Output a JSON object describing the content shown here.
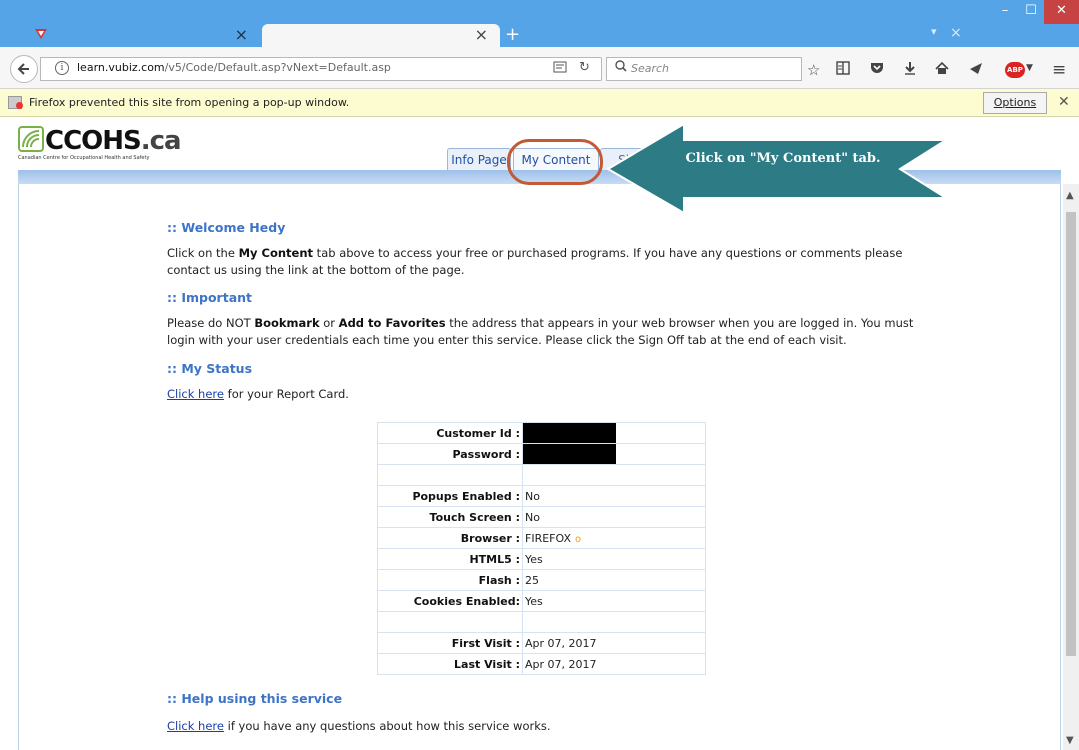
{
  "browser": {
    "tab1_title": "",
    "tab2_title": "",
    "tab_close": "×",
    "new_tab": "+",
    "list_all_tabs": "▾",
    "url_domain": "learn.vubiz.com",
    "url_path": "/v5/Code/Default.asp?vNext=Default.asp",
    "search_placeholder": "Search",
    "popup_message": "Firefox prevented this site from opening a pop-up window.",
    "options_label": "Options",
    "abp_label": "ABP",
    "window_min": "–",
    "window_max": "☐",
    "window_close": "✕"
  },
  "site": {
    "logo": "CCOHS",
    "logo_suffix": ".ca",
    "logo_sub": "Canadian Centre for Occupational Health and Safety",
    "tabs": [
      {
        "label": "Info Page"
      },
      {
        "label": "My Content"
      },
      {
        "label": "Sign Off"
      }
    ]
  },
  "annotation": {
    "callout": "Click on \"My Content\" tab."
  },
  "welcome": {
    "heading": ":: Welcome Hedy",
    "p_1": "Click on the ",
    "p_bold": "My Content",
    "p_2": " tab above to access your free or purchased programs.  If you have any questions or comments please contact us using the link at the bottom of the page."
  },
  "important": {
    "heading": ":: Important",
    "p_1": "Please do NOT ",
    "b_1": "Bookmark",
    "p_2": " or ",
    "b_2": "Add to Favorites",
    "p_3": " the address that appears in your web browser when you are logged in. You must login with your user credentials each time you enter this service. Please click the Sign Off tab at the end of each visit."
  },
  "status": {
    "heading": ":: My Status",
    "link": "Click here",
    "link_suffix": " for your Report Card.",
    "rows": [
      {
        "key": "Customer Id :",
        "value": ""
      },
      {
        "key": "Password :",
        "value": ""
      },
      {
        "key": "",
        "value": ""
      },
      {
        "key": "Popups Enabled :",
        "value": "No"
      },
      {
        "key": "Touch Screen :",
        "value": "No"
      },
      {
        "key": "Browser :",
        "value": "FIREFOX",
        "extra": "o"
      },
      {
        "key": "HTML5 :",
        "value": "Yes"
      },
      {
        "key": "Flash :",
        "value": "25"
      },
      {
        "key": "Cookies Enabled:",
        "value": "Yes"
      },
      {
        "key": "",
        "value": ""
      },
      {
        "key": "First Visit :",
        "value": "Apr 07, 2017"
      },
      {
        "key": "Last Visit :",
        "value": "Apr 07, 2017"
      }
    ]
  },
  "help": {
    "heading": ":: Help using this service",
    "link": "Click here",
    "link_suffix": " if you have any questions about how this service works."
  },
  "colors": {
    "titlebar": "#55a4e8",
    "heading": "#3d74c8",
    "highlight": "#c25a35",
    "callout_fill": "#2d7b84"
  }
}
